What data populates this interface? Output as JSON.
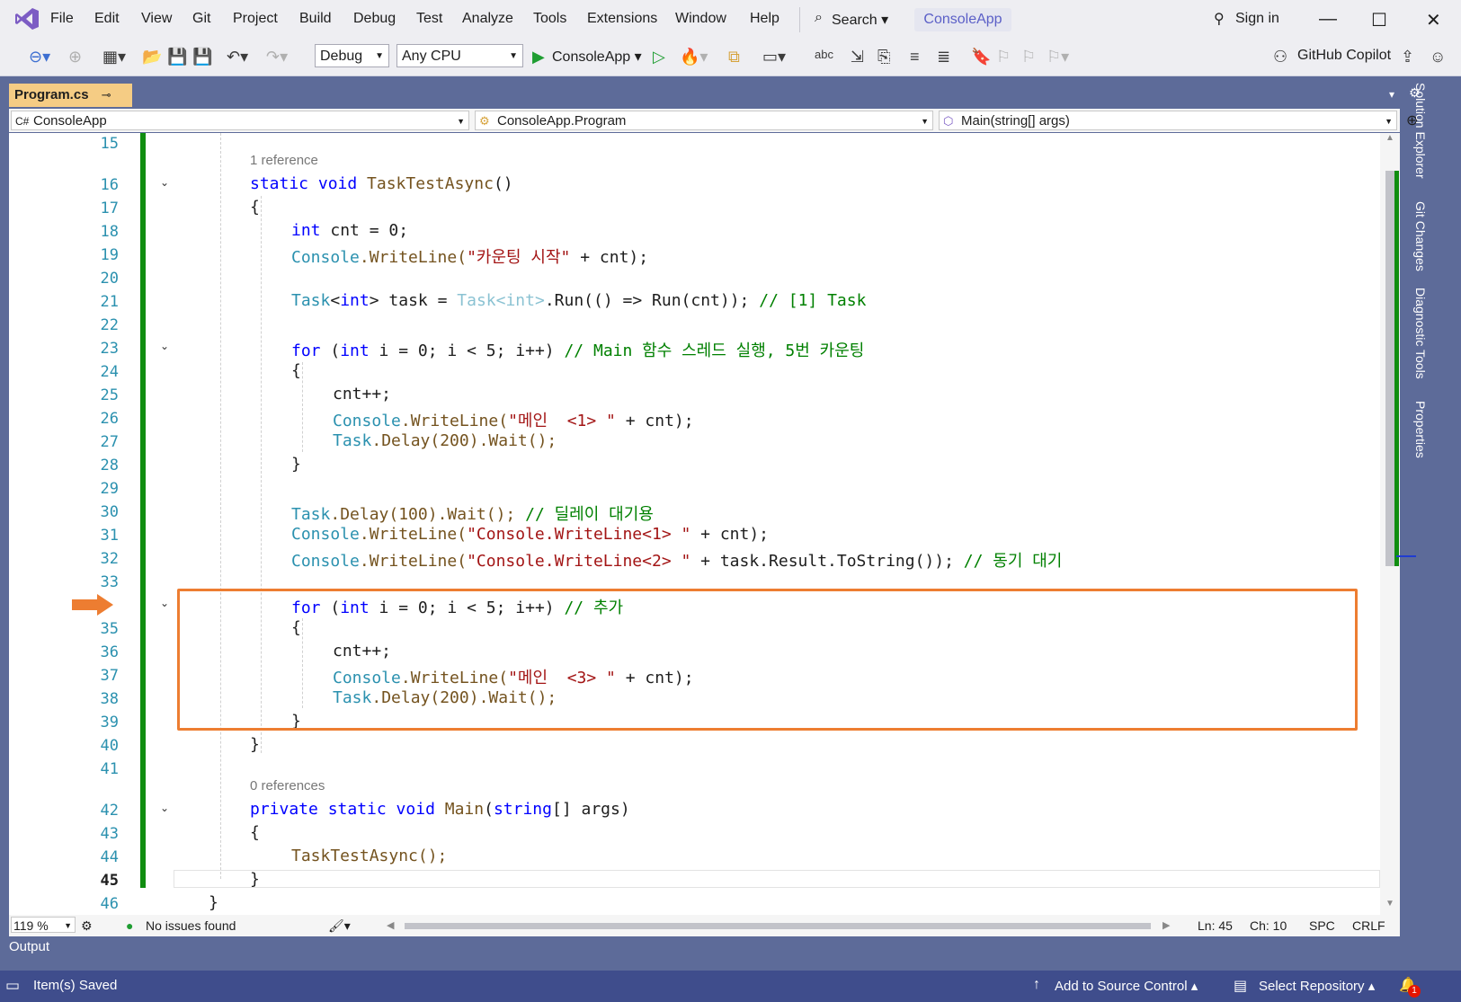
{
  "app": {
    "menu": [
      "File",
      "Edit",
      "View",
      "Git",
      "Project",
      "Build",
      "Debug",
      "Test",
      "Analyze",
      "Tools",
      "Extensions",
      "Window",
      "Help"
    ],
    "search_label": "Search",
    "solution_name": "ConsoleApp",
    "sign_in": "Sign in"
  },
  "toolbar": {
    "config": "Debug",
    "platform": "Any CPU",
    "run_target": "ConsoleApp",
    "copilot": "GitHub Copilot"
  },
  "document_tab": {
    "label": "Program.cs"
  },
  "navbar": {
    "project": "ConsoleApp",
    "class": "ConsoleApp.Program",
    "member": "Main(string[] args)"
  },
  "editor": {
    "line_numbers": [
      "15",
      "16",
      "17",
      "18",
      "19",
      "20",
      "21",
      "22",
      "23",
      "24",
      "25",
      "26",
      "27",
      "28",
      "29",
      "30",
      "31",
      "32",
      "33",
      "35",
      "36",
      "37",
      "38",
      "39",
      "40",
      "41",
      "42",
      "43",
      "44",
      "45",
      "46"
    ],
    "current_line": "45",
    "lens_1": "1 reference",
    "lens_2": "0 references",
    "code": {
      "l16_kw": "static void ",
      "l16_name": "TaskTestAsync",
      "l16_rest": "()",
      "open_brace": "{",
      "close_brace": "}",
      "l18_kw": "int",
      "l18_rest": " cnt = 0;",
      "console": "Console",
      "writeline": ".WriteLine(",
      "l19_str": "\"카운팅 시작\"",
      "l19_rest": " + cnt);",
      "l21_task": "Task",
      "l21_lt": "<",
      "l21_int": "int",
      "l21_mid": "> task = ",
      "l21_task2": "Task<int>",
      "l21_run": ".Run(() => Run(cnt)); ",
      "l21_cm": "// [1] Task",
      "for_kw": "for",
      "for_open": " (",
      "int_kw": "int",
      "for_cond": " i = 0; i < 5; i++) ",
      "l23_cm": "// Main 함수 스레드 실행, 5번 카운팅",
      "cntpp": "cnt++;",
      "l26_str": "\"메인  <1> \"",
      "plus_cnt": " + cnt);",
      "task": "Task",
      "delay200": ".Delay(200).Wait();",
      "delay100": ".Delay(100).Wait(); ",
      "l30_cm": "// 딜레이 대기용",
      "l31_str": "\"Console.WriteLine<1> \"",
      "l32_str": "\"Console.WriteLine<2> \"",
      "l32_rest": " + task.Result.ToString()); ",
      "l32_cm": "// 동기 대기",
      "l34_cm": "// 추가",
      "l37_str": "\"메인  <3> \"",
      "l42_kw": "private static void ",
      "l42_name": "Main",
      "l42_open": "(",
      "l42_string": "string",
      "l42_rest": "[] args)",
      "l44_call": "TaskTestAsync();"
    }
  },
  "editor_status": {
    "zoom": "119 %",
    "issues": "No issues found",
    "ln": "Ln: 45",
    "ch": "Ch: 10",
    "spc": "SPC",
    "crlf": "CRLF"
  },
  "right_tabs": [
    "Solution Explorer",
    "Git Changes",
    "Diagnostic Tools",
    "Properties"
  ],
  "output_label": "Output",
  "statusbar": {
    "saved": "Item(s) Saved",
    "source_control": "Add to Source Control",
    "repository": "Select Repository",
    "notifications": "1"
  },
  "colors": {
    "accent_highlight": "#ed7d31",
    "change_bar": "#108d10",
    "status_bar": "#3f4d8c"
  }
}
